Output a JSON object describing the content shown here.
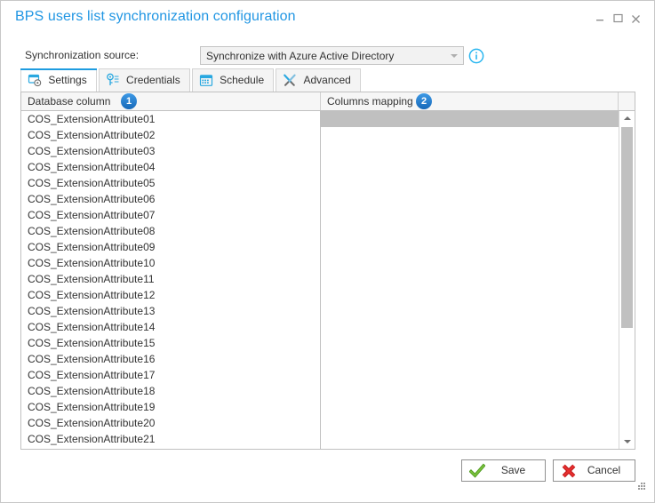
{
  "window": {
    "title": "BPS users list synchronization configuration",
    "controls": {
      "minimize": "–",
      "maximize": "□",
      "close": "×"
    },
    "accent_color": "#2196e3"
  },
  "source": {
    "label": "Synchronization source:",
    "selected": "Synchronize with Azure Active Directory",
    "options": [
      "Synchronize with Azure Active Directory"
    ],
    "info_icon": "info-circle-icon"
  },
  "tabs": [
    {
      "label": "Settings",
      "icon": "settings-card-gear-icon",
      "active": true
    },
    {
      "label": "Credentials",
      "icon": "key-icon",
      "active": false
    },
    {
      "label": "Schedule",
      "icon": "calendar-icon",
      "active": false
    },
    {
      "label": "Advanced",
      "icon": "tools-wrench-screwdriver-icon",
      "active": false
    }
  ],
  "grid": {
    "columns": [
      {
        "header": "Database column",
        "badge": "1"
      },
      {
        "header": "Columns mapping",
        "badge": "2"
      }
    ],
    "database_columns": [
      "COS_ExtensionAttribute01",
      "COS_ExtensionAttribute02",
      "COS_ExtensionAttribute03",
      "COS_ExtensionAttribute04",
      "COS_ExtensionAttribute05",
      "COS_ExtensionAttribute06",
      "COS_ExtensionAttribute07",
      "COS_ExtensionAttribute08",
      "COS_ExtensionAttribute09",
      "COS_ExtensionAttribute10",
      "COS_ExtensionAttribute11",
      "COS_ExtensionAttribute12",
      "COS_ExtensionAttribute13",
      "COS_ExtensionAttribute14",
      "COS_ExtensionAttribute15",
      "COS_ExtensionAttribute16",
      "COS_ExtensionAttribute17",
      "COS_ExtensionAttribute18",
      "COS_ExtensionAttribute19",
      "COS_ExtensionAttribute20",
      "COS_ExtensionAttribute21"
    ],
    "columns_mapping": [
      "",
      "",
      "",
      "",
      "",
      "",
      "",
      "",
      "",
      "",
      "",
      "",
      "",
      "",
      "",
      "",
      "",
      "",
      "",
      "",
      ""
    ],
    "selected_row_index": 0,
    "selected_row_color": "#c0c0c0"
  },
  "scrollbar": {
    "up_arrow": "triangle-up-icon",
    "down_arrow": "triangle-down-icon"
  },
  "footer": {
    "save_label": "Save",
    "save_icon": "green-check-icon",
    "cancel_label": "Cancel",
    "cancel_icon": "red-cross-icon"
  }
}
